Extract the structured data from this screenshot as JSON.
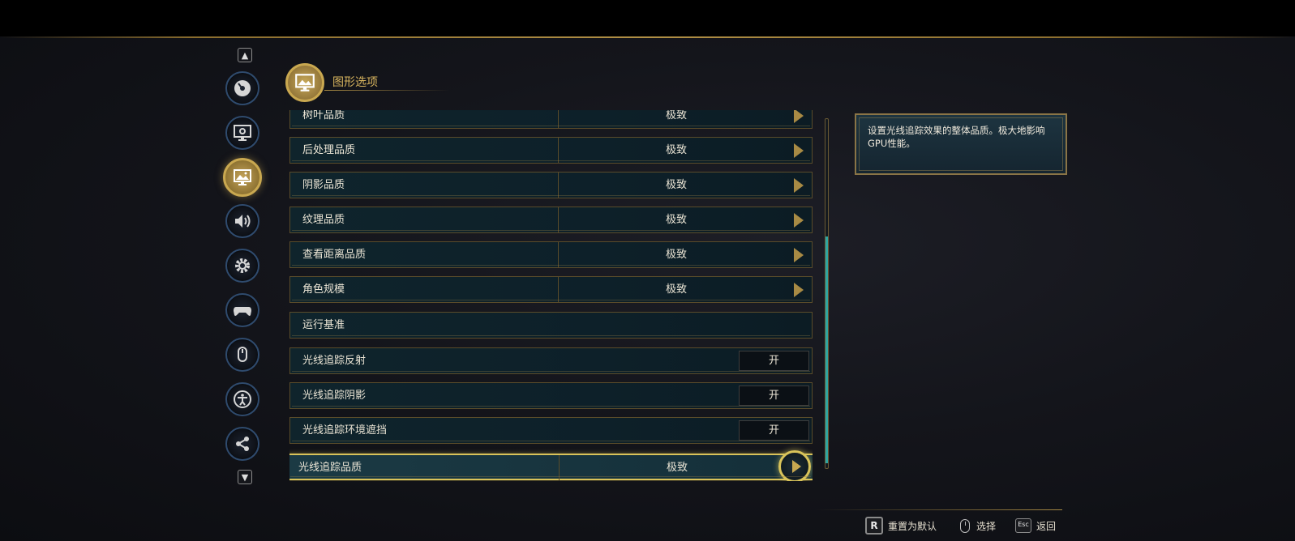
{
  "header": {
    "title": "图形选项",
    "icon": "monitor-image-icon"
  },
  "sidebar": {
    "up_arrow_icon": "arrow-up-icon",
    "down_arrow_icon": "arrow-down-icon",
    "items": [
      {
        "icon": "disc-icon",
        "active": false
      },
      {
        "icon": "monitor-gear-icon",
        "active": false
      },
      {
        "icon": "monitor-image-icon",
        "active": true
      },
      {
        "icon": "speaker-icon",
        "active": false
      },
      {
        "icon": "gear-icon",
        "active": false
      },
      {
        "icon": "gamepad-icon",
        "active": false
      },
      {
        "icon": "mouse-icon",
        "active": false
      },
      {
        "icon": "accessibility-icon",
        "active": false
      },
      {
        "icon": "share-network-icon",
        "active": false
      }
    ]
  },
  "settings": [
    {
      "label": "树叶品质",
      "type": "select",
      "value": "极致"
    },
    {
      "label": "后处理品质",
      "type": "select",
      "value": "极致"
    },
    {
      "label": "阴影品质",
      "type": "select",
      "value": "极致"
    },
    {
      "label": "纹理品质",
      "type": "select",
      "value": "极致"
    },
    {
      "label": "查看距离品质",
      "type": "select",
      "value": "极致"
    },
    {
      "label": "角色规模",
      "type": "select",
      "value": "极致"
    },
    {
      "label": "运行基准",
      "type": "action",
      "value": ""
    },
    {
      "label": "光线追踪反射",
      "type": "toggle",
      "value": "开"
    },
    {
      "label": "光线追踪阴影",
      "type": "toggle",
      "value": "开"
    },
    {
      "label": "光线追踪环境遮挡",
      "type": "toggle",
      "value": "开"
    },
    {
      "label": "光线追踪品质",
      "type": "select",
      "value": "极致",
      "selected": true
    }
  ],
  "description": {
    "text": "设置光线追踪效果的整体品质。极大地影响GPU性能。"
  },
  "footer": {
    "reset": {
      "key": "R",
      "label": "重置为默认"
    },
    "select": {
      "icon": "mouse-icon",
      "label": "选择"
    },
    "back": {
      "key": "Esc",
      "label": "返回"
    }
  },
  "colors": {
    "gold": "#c9a850",
    "selected_border": "#d9c35a",
    "row_bg": "#0f242c",
    "scroll_thumb": "#2fa5a0"
  }
}
